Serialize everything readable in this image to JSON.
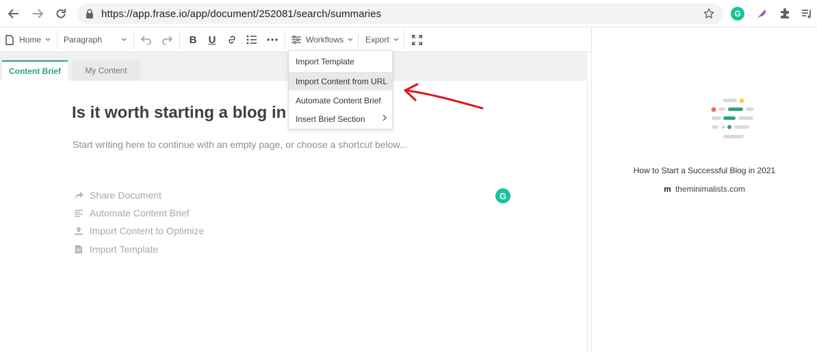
{
  "browser": {
    "url": "https://app.frase.io/app/document/252081/search/summaries"
  },
  "toolbar": {
    "home_label": "Home",
    "paragraph_label": "Paragraph",
    "workflows_label": "Workflows",
    "export_label": "Export"
  },
  "tabs": [
    {
      "label": "Content Brief",
      "active": true
    },
    {
      "label": "My Content",
      "active": false
    }
  ],
  "document": {
    "title": "Is it worth starting a blog in",
    "hint": "Start writing here to continue with an empty page, or choose a shortcut below..."
  },
  "shortcuts": [
    {
      "label": "Share Document",
      "icon": "share-icon"
    },
    {
      "label": "Automate Content Brief",
      "icon": "lines-icon"
    },
    {
      "label": "Import Content to Optimize",
      "icon": "upload-icon"
    },
    {
      "label": "Import Template",
      "icon": "file-icon"
    }
  ],
  "workflows_menu": [
    {
      "label": "Import Template",
      "highlighted": false
    },
    {
      "label": "Import Content from URL",
      "highlighted": true
    },
    {
      "label": "Automate Content Brief",
      "highlighted": false
    },
    {
      "label": "Insert Brief Section",
      "highlighted": false,
      "submenu": true
    }
  ],
  "right_panel": {
    "title": "How to Start a Successful Blog in 2021",
    "source_glyph": "m",
    "source": "theminimalists.com"
  },
  "colors": {
    "accent": "#2aa37e",
    "grammarly": "#15c39a",
    "annotation_arrow": "#e0191f"
  }
}
